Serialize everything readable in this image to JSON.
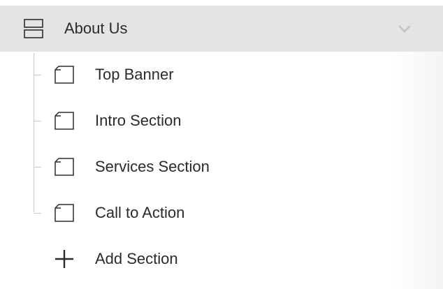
{
  "page": {
    "title": "About Us",
    "icon": "page-layout-icon",
    "expand_icon": "chevron-down-icon"
  },
  "sections": [
    {
      "label": "Top Banner",
      "icon": "section-icon"
    },
    {
      "label": "Intro Section",
      "icon": "section-icon"
    },
    {
      "label": "Services Section",
      "icon": "section-icon"
    },
    {
      "label": "Call to Action",
      "icon": "section-icon"
    }
  ],
  "add_section": {
    "label": "Add Section",
    "icon": "plus-icon"
  },
  "colors": {
    "header_background": "#e4e4e4",
    "text": "#2b2b2b",
    "tree_line": "#c9c9c9"
  }
}
